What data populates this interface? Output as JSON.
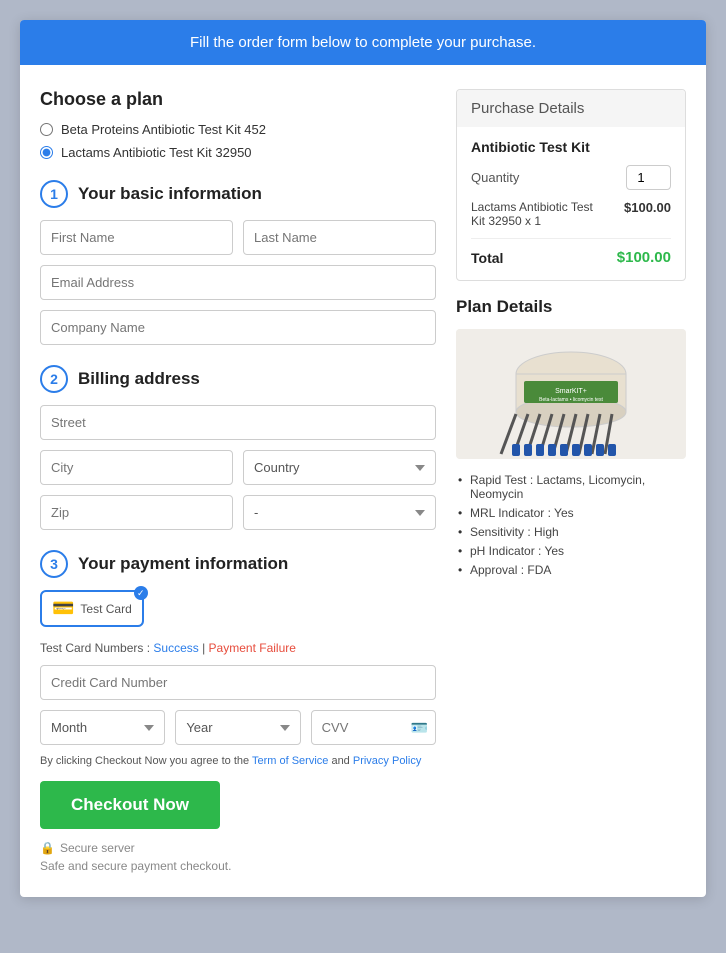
{
  "banner": {
    "text": "Fill the order form below to complete your purchase."
  },
  "left": {
    "choose_plan": {
      "title": "Choose a plan",
      "options": [
        {
          "label": "Beta Proteins Antibiotic Test Kit 452",
          "selected": false
        },
        {
          "label": "Lactams Antibiotic Test Kit 32950",
          "selected": true
        }
      ]
    },
    "step1": {
      "number": "1",
      "label": "Your basic information",
      "fields": {
        "first_name": {
          "placeholder": "First Name"
        },
        "last_name": {
          "placeholder": "Last Name"
        },
        "email": {
          "placeholder": "Email Address"
        },
        "company": {
          "placeholder": "Company Name"
        }
      }
    },
    "step2": {
      "number": "2",
      "label": "Billing address",
      "fields": {
        "street": {
          "placeholder": "Street"
        },
        "city": {
          "placeholder": "City"
        },
        "country": {
          "placeholder": "Country"
        },
        "zip": {
          "placeholder": "Zip"
        },
        "state": {
          "placeholder": "-"
        }
      }
    },
    "step3": {
      "number": "3",
      "label": "Your payment information",
      "payment_method": {
        "card_label": "Test Card"
      },
      "test_card_label": "Test Card Numbers :",
      "success_link": "Success",
      "failure_link": "Payment Failure",
      "fields": {
        "cc_number": {
          "placeholder": "Credit Card Number"
        },
        "month": {
          "placeholder": "Month"
        },
        "year": {
          "placeholder": "Year"
        },
        "cvv": {
          "placeholder": "CVV"
        }
      }
    },
    "terms": {
      "prefix": "By clicking Checkout Now you agree to the ",
      "tos_label": "Term of Service",
      "middle": " and ",
      "privacy_label": "Privacy Policy"
    },
    "checkout_button": "Checkout Now",
    "secure_label": "Secure server",
    "safe_label": "Safe and secure payment checkout."
  },
  "right": {
    "purchase_details": {
      "title": "Purchase Details",
      "product_name": "Antibiotic Test Kit",
      "quantity_label": "Quantity",
      "quantity_value": "1",
      "item_name": "Lactams Antibiotic Test\nKit 32950 x 1",
      "item_price": "$100.00",
      "total_label": "Total",
      "total_price": "$100.00"
    },
    "plan_details": {
      "title": "Plan Details",
      "features": [
        "Rapid Test : Lactams, Licomycin, Neomycin",
        "MRL Indicator : Yes",
        "Sensitivity : High",
        "pH Indicator : Yes",
        "Approval : FDA"
      ]
    }
  }
}
